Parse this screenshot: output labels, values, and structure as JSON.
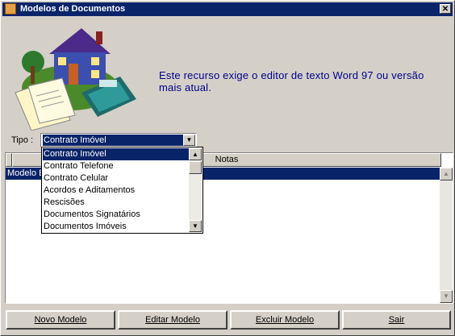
{
  "window": {
    "title": "Modelos de Documentos",
    "close_glyph": "✕"
  },
  "info_text": "Este recurso exige o editor de texto Word 97 ou versão mais atual.",
  "tipo": {
    "label": "Tipo :",
    "selected": "Contrato Imóvel",
    "options": [
      "Contrato Imóvel",
      "Contrato Telefone",
      "Contrato Celular",
      "Acordos e Aditamentos",
      "Rescisões",
      "Documentos Signatários",
      "Documentos Imóveis"
    ]
  },
  "grid": {
    "columns": [
      "",
      "Notas"
    ],
    "rows": [
      {
        "name": "Modelo E"
      }
    ]
  },
  "buttons": {
    "novo": "Novo Modelo",
    "editar": "Editar Modelo",
    "excluir": "Excluir Modelo",
    "sair": "Sair"
  }
}
